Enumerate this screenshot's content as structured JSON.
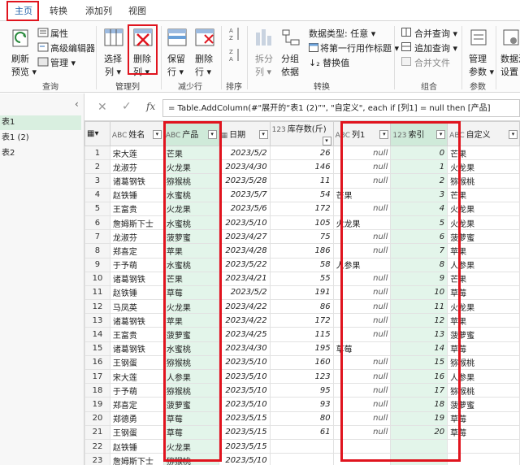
{
  "tabs": [
    "主页",
    "转换",
    "添加列",
    "视图"
  ],
  "ribbon": {
    "refresh_label": "刷新",
    "preview_label": "预览",
    "properties_label": "属性",
    "advanced_editor_label": "高级编辑器",
    "manage_label": "管理",
    "group_query": "查询",
    "choose_columns": "选择",
    "choose_columns_2": "列",
    "remove_columns": "删除",
    "remove_columns_2": "列",
    "group_manage_columns": "管理列",
    "keep_rows": "保留",
    "keep_rows_2": "行",
    "remove_rows": "删除",
    "remove_rows_2": "行",
    "group_reduce_rows": "减少行",
    "group_sort": "排序",
    "split_column": "拆分",
    "split_column_2": "列",
    "group_by": "分组",
    "group_by_2": "依据",
    "data_type_label": "数据类型: 任意",
    "first_row_header": "将第一行用作标题",
    "replace_values": "替换值",
    "group_transform": "转换",
    "merge_queries": "合并查询",
    "append_queries": "追加查询",
    "combine_files": "合并文件",
    "group_combine": "组合",
    "manage_params": "管理",
    "manage_params_2": "参数",
    "group_params": "参数",
    "data_source": "数据源",
    "data_source_2": "设置"
  },
  "queries": [
    "表1",
    "表1 (2)",
    "表2"
  ],
  "formula_text": "= Table.AddColumn(#\"展开的“表1 (2)”\", \"自定义\", each if [列1] = null then [产品]",
  "columns": [
    {
      "type": "ABC",
      "name": "姓名"
    },
    {
      "type": "ABC",
      "name": "产品"
    },
    {
      "type": "▦",
      "name": "日期"
    },
    {
      "type": "123",
      "name": "库存数(斤)"
    },
    {
      "type": "ABC",
      "name": "列1"
    },
    {
      "type": "123",
      "name": "索引"
    },
    {
      "type": "ABC",
      "name": "自定义"
    }
  ],
  "rows": [
    [
      "宋大莲",
      "芒果",
      "2023/5/2",
      "26",
      "null",
      "0",
      "芒果"
    ],
    [
      "龙淑芬",
      "火龙果",
      "2023/4/30",
      "146",
      "null",
      "1",
      "火龙果"
    ],
    [
      "诸葛钢铁",
      "猕猴桃",
      "2023/5/28",
      "11",
      "null",
      "2",
      "猕猴桃"
    ],
    [
      "赵铁锤",
      "水蜜桃",
      "2023/5/7",
      "54",
      "芒果",
      "3",
      "芒果"
    ],
    [
      "王富贵",
      "火龙果",
      "2023/5/6",
      "172",
      "null",
      "4",
      "火龙果"
    ],
    [
      "詹姆斯下士",
      "水蜜桃",
      "2023/5/10",
      "105",
      "火龙果",
      "5",
      "火龙果"
    ],
    [
      "龙淑芬",
      "菠萝蜜",
      "2023/4/27",
      "75",
      "null",
      "6",
      "菠萝蜜"
    ],
    [
      "郑喜定",
      "苹果",
      "2023/4/28",
      "186",
      "null",
      "7",
      "苹果"
    ],
    [
      "于予萌",
      "水蜜桃",
      "2023/5/22",
      "58",
      "人参果",
      "8",
      "人参果"
    ],
    [
      "诸葛钢铁",
      "芒果",
      "2023/4/21",
      "55",
      "null",
      "9",
      "芒果"
    ],
    [
      "赵铁锤",
      "草莓",
      "2023/5/2",
      "191",
      "null",
      "10",
      "草莓"
    ],
    [
      "马凤英",
      "火龙果",
      "2023/4/22",
      "86",
      "null",
      "11",
      "火龙果"
    ],
    [
      "诸葛钢铁",
      "苹果",
      "2023/4/22",
      "172",
      "null",
      "12",
      "苹果"
    ],
    [
      "王富贵",
      "菠萝蜜",
      "2023/4/25",
      "115",
      "null",
      "13",
      "菠萝蜜"
    ],
    [
      "诸葛钢铁",
      "水蜜桃",
      "2023/4/30",
      "195",
      "草莓",
      "14",
      "草莓"
    ],
    [
      "王钢蛋",
      "猕猴桃",
      "2023/5/10",
      "160",
      "null",
      "15",
      "猕猴桃"
    ],
    [
      "宋大莲",
      "人参果",
      "2023/5/10",
      "123",
      "null",
      "16",
      "人参果"
    ],
    [
      "于予萌",
      "猕猴桃",
      "2023/5/10",
      "95",
      "null",
      "17",
      "猕猴桃"
    ],
    [
      "郑喜定",
      "菠萝蜜",
      "2023/5/10",
      "93",
      "null",
      "18",
      "菠萝蜜"
    ],
    [
      "郑德勇",
      "草莓",
      "2023/5/15",
      "80",
      "null",
      "19",
      "草莓"
    ],
    [
      "王钢蛋",
      "草莓",
      "2023/5/15",
      "61",
      "null",
      "20",
      "草莓"
    ],
    [
      "赵铁锤",
      "火龙果",
      "2023/5/15",
      "",
      "",
      "",
      ""
    ],
    [
      "詹姆斯下士",
      "猕猴桃",
      "2023/5/10",
      "",
      "",
      "",
      ""
    ]
  ],
  "colors": {
    "accent_red": "#e0141e",
    "selected_green": "#e3f5ea",
    "tab_blue": "#1f5fa8"
  }
}
